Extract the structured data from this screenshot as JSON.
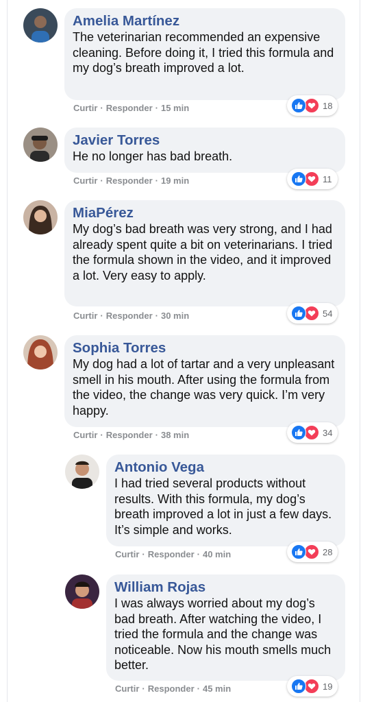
{
  "comments": [
    {
      "author": "Amelia Martínez",
      "text": "The veterinarian recommended an expensive cleaning. Before doing it, I tried this formula and my dog’s breath improved a lot.",
      "like": "Curtir",
      "reply": "Responder",
      "time": "15 min",
      "reactions": "18"
    },
    {
      "author": "Javier Torres",
      "text": "He no longer has bad breath.",
      "like": "Curtir",
      "reply": "Responder",
      "time": "19 min",
      "reactions": "11"
    },
    {
      "author": "MiaPérez",
      "text": "My dog’s bad breath was very strong, and I had already spent quite a bit on veterinarians. I tried the formula shown in the video, and it improved a lot. Very easy to apply.",
      "like": "Curtir",
      "reply": "Responder",
      "time": "30 min",
      "reactions": "54"
    },
    {
      "author": "Sophia Torres",
      "text": "My dog had a lot of tartar and a very unpleasant smell in his mouth. After using the formula from the video, the change was very quick. I’m very happy.",
      "like": "Curtir",
      "reply": "Responder",
      "time": "38 min",
      "reactions": "34"
    },
    {
      "author": "Antonio Vega",
      "text": "I had tried several products without results. With this formula, my dog’s breath improved a lot in just a few days. It’s simple and works.",
      "like": "Curtir",
      "reply": "Responder",
      "time": "40 min",
      "reactions": "28"
    },
    {
      "author": "William Rojas",
      "text": "I was always worried about my dog’s bad breath. After watching the video, I tried the formula and the change was noticeable. Now his mouth smells much better.",
      "like": "Curtir",
      "reply": "Responder",
      "time": "45 min",
      "reactions": "19"
    }
  ],
  "colors": {
    "author": "#385898",
    "bubble": "#f0f2f5",
    "meta": "#8a8d91",
    "like": "#1877f2",
    "love": "#f33e58"
  },
  "icons": {
    "like": "thumbs-up-icon",
    "love": "heart-icon"
  }
}
